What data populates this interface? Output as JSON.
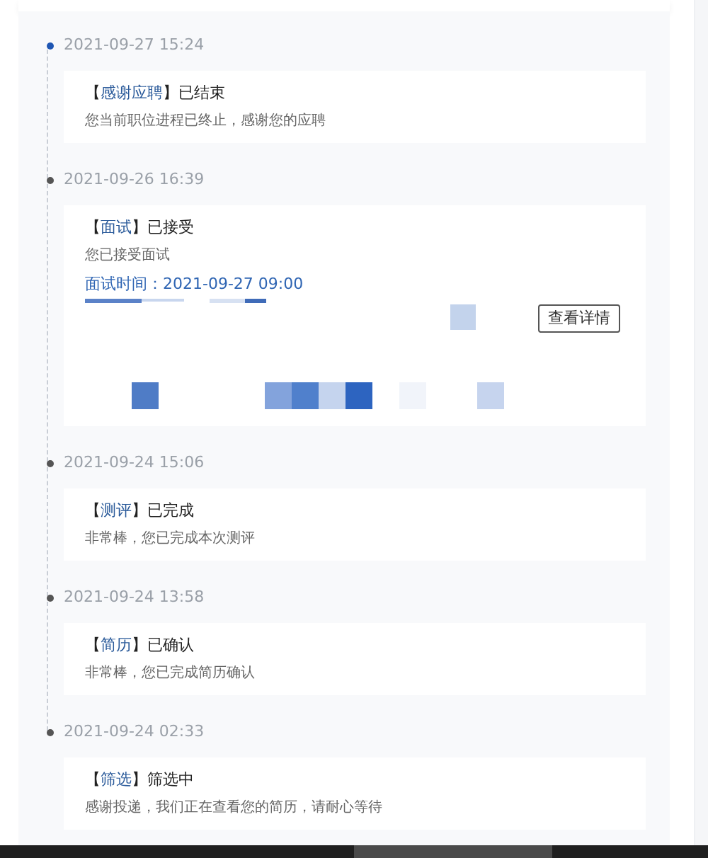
{
  "timeline": [
    {
      "time": "2021-09-27 15:24",
      "current": true,
      "brackets": [
        "【",
        "】"
      ],
      "tag": "感谢应聘",
      "status": "已结束",
      "message": "您当前职位进程已终止，感谢您的应聘"
    },
    {
      "time": "2021-09-26 16:39",
      "current": false,
      "brackets": [
        "【",
        "】"
      ],
      "tag": "面试",
      "status": "已接受",
      "message": "您已接受面试",
      "interview_time": "面试时间：2021-09-27 09:00",
      "button": "查看详情"
    },
    {
      "time": "2021-09-24 15:06",
      "current": false,
      "brackets": [
        "【",
        "】"
      ],
      "tag": "测评",
      "status": "已完成",
      "message": "非常棒，您已完成本次测评"
    },
    {
      "time": "2021-09-24 13:58",
      "current": false,
      "brackets": [
        "【",
        "】"
      ],
      "tag": "简历",
      "status": "已确认",
      "message": "非常棒，您已完成简历确认"
    },
    {
      "time": "2021-09-24 02:33",
      "current": false,
      "brackets": [
        "【",
        "】"
      ],
      "tag": "筛选",
      "status": "筛选中",
      "message": "感谢投递，我们正在查看您的简历，请耐心等待"
    }
  ]
}
